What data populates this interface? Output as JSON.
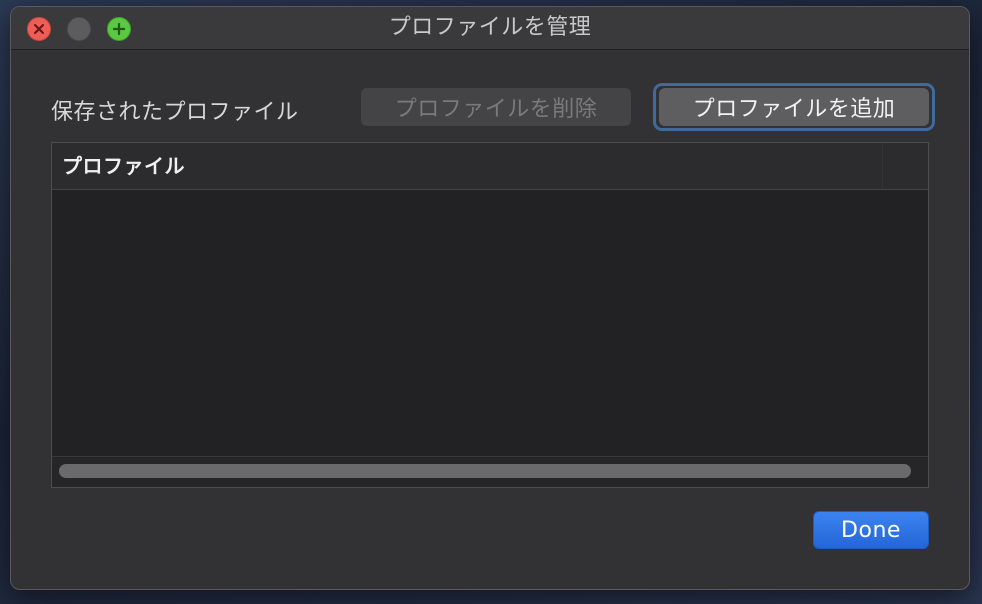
{
  "window": {
    "title": "プロファイルを管理"
  },
  "controls": {
    "close": "close",
    "minimize": "minimize",
    "zoom": "zoom"
  },
  "main": {
    "saved_label": "保存されたプロファイル",
    "delete_button": "プロファイルを削除",
    "add_button": "プロファイルを追加",
    "table": {
      "columns": [
        "プロファイル"
      ],
      "rows": []
    },
    "done_button": "Done"
  },
  "colors": {
    "accent": "#2566d7",
    "focus_ring": "#3e6a9c",
    "close": "#ec5f57",
    "zoom": "#5ac840"
  },
  "icons": {
    "close": "close-x-icon",
    "zoom": "plus-icon"
  }
}
